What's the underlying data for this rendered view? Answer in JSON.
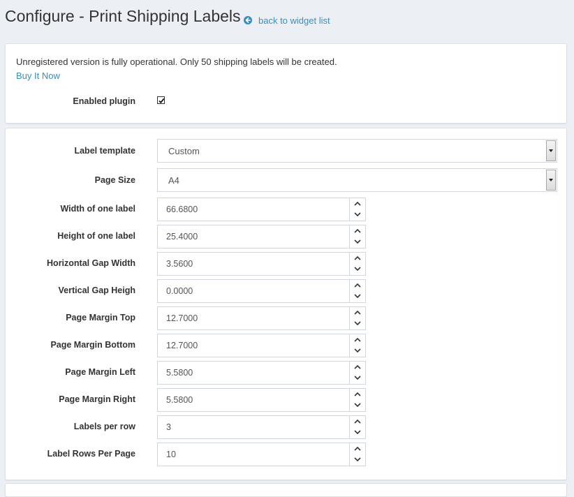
{
  "header": {
    "title": "Configure - Print Shipping Labels",
    "back_link": "back to widget list",
    "back_icon": "circle-arrow-left-icon"
  },
  "license": {
    "notice": "Unregistered version is fully operational. Only 50 shipping labels will be created.",
    "buy_link": "Buy It Now"
  },
  "plugin": {
    "enabled_label": "Enabled plugin",
    "enabled": true
  },
  "form": {
    "label_template": {
      "label": "Label template",
      "value": "Custom"
    },
    "page_size": {
      "label": "Page Size",
      "value": "A4"
    },
    "fields": [
      {
        "label": "Width of one label",
        "value": "66.6800"
      },
      {
        "label": "Height of one label",
        "value": "25.4000"
      },
      {
        "label": "Horizontal Gap Width",
        "value": "3.5600"
      },
      {
        "label": "Vertical Gap Heigh",
        "value": "0.0000"
      },
      {
        "label": "Page Margin Top",
        "value": "12.7000"
      },
      {
        "label": "Page Margin Bottom",
        "value": "12.7000"
      },
      {
        "label": "Page Margin Left",
        "value": "5.5800"
      },
      {
        "label": "Page Margin Right",
        "value": "5.5800"
      },
      {
        "label": "Labels per row",
        "value": "3"
      },
      {
        "label": "Label Rows Per Page",
        "value": "10"
      }
    ]
  },
  "colors": {
    "link": "#3c8dbc",
    "background": "#ecf0f5",
    "panel": "#ffffff",
    "border": "#d2d6de"
  }
}
